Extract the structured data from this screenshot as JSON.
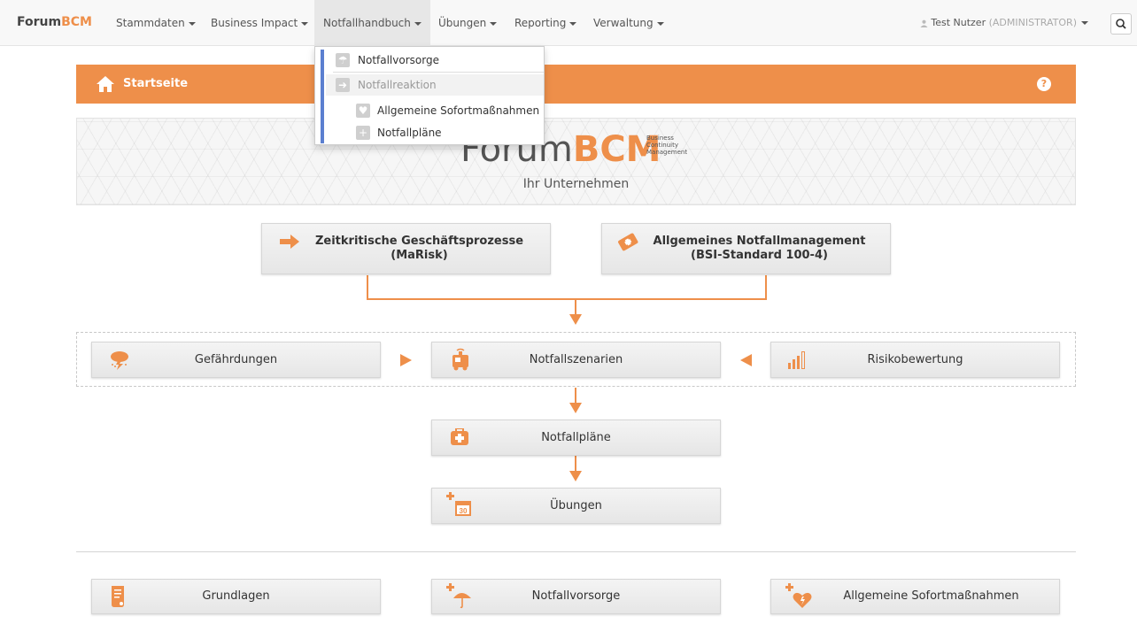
{
  "brand": {
    "part1": "Forum",
    "part2": "BCM"
  },
  "nav": {
    "items": [
      {
        "label": "Stammdaten"
      },
      {
        "label": "Business Impact"
      },
      {
        "label": "Notfallhandbuch"
      },
      {
        "label": "Übungen"
      },
      {
        "label": "Reporting"
      },
      {
        "label": "Verwaltung"
      }
    ],
    "user_name": "Test Nutzer",
    "user_role": "(ADMINISTRATOR)"
  },
  "dropdown": {
    "items": [
      {
        "label": "Notfallvorsorge"
      },
      {
        "label": "Notfallreaktion"
      },
      {
        "label": "Allgemeine Sofortmaßnahmen"
      },
      {
        "label": "Notfallpläne"
      }
    ]
  },
  "header": {
    "title": "Startseite",
    "help": "?"
  },
  "banner": {
    "logo_part1": "Forum",
    "logo_part2": "BCM",
    "tagline": [
      "Business",
      "Continuity",
      "Management"
    ],
    "subtitle": "Ihr Unternehmen"
  },
  "flow": {
    "top_left": {
      "line1": "Zeitkritische Geschäftsprozesse",
      "line2": "(MaRisk)"
    },
    "top_right": {
      "line1": "Allgemeines Notfallmanagement",
      "line2": "(BSI-Standard 100-4)"
    },
    "gefaehrdungen": "Gefährdungen",
    "notfallszenarien": "Notfallszenarien",
    "risikobewertung": "Risikobewertung",
    "notfallplaene": "Notfallpläne",
    "uebungen": "Übungen",
    "calendar_day": "30"
  },
  "bottom": {
    "grundlagen": "Grundlagen",
    "notfallvorsorge": "Notfallvorsorge",
    "sofortmassnahmen": "Allgemeine Sofortmaßnahmen"
  },
  "colors": {
    "accent": "#ee8f4a",
    "dropdown_bar": "#5b7fd0"
  }
}
